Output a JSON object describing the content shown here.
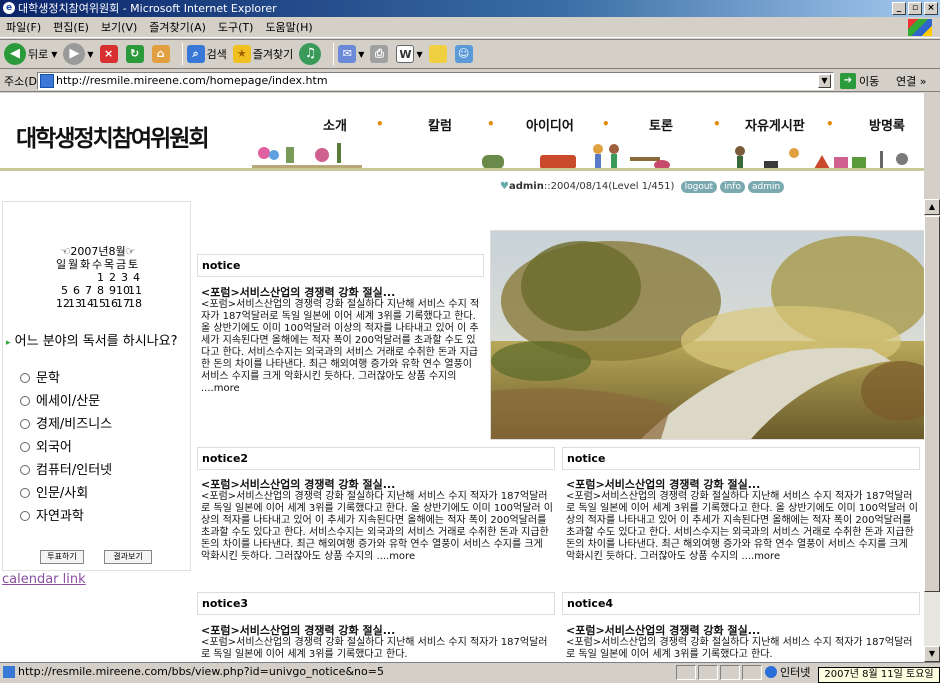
{
  "window": {
    "title": "대학생정치참여위원회 - Microsoft Internet Explorer"
  },
  "menu": [
    "파일(F)",
    "편집(E)",
    "보기(V)",
    "즐겨찾기(A)",
    "도구(T)",
    "도움말(H)"
  ],
  "toolbar": {
    "back": "뒤로",
    "search": "검색",
    "favorites": "즐겨찾기"
  },
  "address": {
    "label": "주소(D)",
    "url": "http://resmile.mireene.com/homepage/index.htm",
    "go": "이동",
    "links": "연결 »"
  },
  "site": {
    "logo": "대학생정치참여위원회",
    "nav": [
      "소개",
      "칼럼",
      "아이디어",
      "토론",
      "자유게시판",
      "방명록"
    ],
    "user": {
      "name": "admin",
      "info": "::2004/08/14(Level 1/451)",
      "buttons": [
        "logout",
        "info",
        "admin"
      ]
    }
  },
  "calendar": {
    "title": "☜2007년8월☞",
    "weekdays": [
      "일",
      "월",
      "화",
      "수",
      "목",
      "금",
      "토"
    ],
    "rows": [
      [
        "",
        "",
        "",
        "1",
        "2",
        "3",
        "4"
      ],
      [
        "5",
        "6",
        "7",
        "8",
        "9",
        "10",
        "11"
      ],
      [
        "12",
        "13",
        "14",
        "15",
        "16",
        "17",
        "18"
      ]
    ]
  },
  "poll": {
    "question": "어느 분야의 독서를 하시나요?",
    "options": [
      "문학",
      "에세이/산문",
      "경제/비즈니스",
      "외국어",
      "컴퓨터/인터넷",
      "인문/사회",
      "자연과학"
    ],
    "vote": "투표하기",
    "results": "결과보기"
  },
  "calendar_link": "calendar link",
  "notices": [
    {
      "title": "notice",
      "headline": "<포럼>서비스산업의 경쟁력 강화 절실...",
      "body": "<포럼>서비스산업의 경쟁력 강화 절실하다 지난해 서비스 수지 적자가 187억달러로 독일 일본에 이어 세계 3위를 기록했다고 한다. 올 상반기에도 이미 100억달러 이상의 적자를 나타내고 있어 이 추세가 지속된다면 올해에는 적자 폭이 200억달러를 초과할 수도 있다고 한다. 서비스수지는 외국과의 서비스 거래로 수취한 돈과 지급한 돈의 차이를 나타낸다. 최근 해외여행 증가와 유학 연수 열풍이 서비스 수지를 크게 악화시킨 듯하다. 그러잖아도 상품 수지의 ....",
      "more": "more"
    },
    {
      "title": "notice2",
      "headline": "<포럼>서비스산업의 경쟁력 강화 절실...",
      "body": "<포럼>서비스산업의 경쟁력 강화 절실하다 지난해 서비스 수지 적자가 187억달러로 독일 일본에 이어 세계 3위를 기록했다고 한다. 올 상반기에도 이미 100억달러 이상의 적자를 나타내고 있어 이 추세가 지속된다면 올해에는 적자 폭이 200억달러를 초과할 수도 있다고 한다. 서비스수지는 외국과의 서비스 거래로 수취한 돈과 지급한 돈의 차이를 나타낸다. 최근 해외여행 증가와 유학 연수 열풍이 서비스 수지를 크게 악화시킨 듯하다. 그러잖아도 상품 수지의 ....",
      "more": "more"
    },
    {
      "title": "notice",
      "headline": "<포럼>서비스산업의 경쟁력 강화 절실...",
      "body": "<포럼>서비스산업의 경쟁력 강화 절실하다 지난해 서비스 수지 적자가 187억달러로 독일 일본에 이어 세계 3위를 기록했다고 한다. 올 상반기에도 이미 100억달러 이상의 적자를 나타내고 있어 이 추세가 지속된다면 올해에는 적자 폭이 200억달러를 초과할 수도 있다고 한다. 서비스수지는 외국과의 서비스 거래로 수취한 돈과 지급한 돈의 차이를 나타낸다. 최근 해외여행 증가와 유학 연수 열풍이 서비스 수지를 크게 악화시킨 듯하다. 그러잖아도 상품 수지의 ....",
      "more": "more"
    },
    {
      "title": "notice3",
      "headline": "<포럼>서비스산업의 경쟁력 강화 절실...",
      "body": "<포럼>서비스산업의 경쟁력 강화 절실하다 지난해 서비스 수지 적자가 187억달러로 독일 일본에 이어 세계 3위를 기록했다고 한다.",
      "more": ""
    },
    {
      "title": "notice4",
      "headline": "<포럼>서비스산업의 경쟁력 강화 절실...",
      "body": "<포럼>서비스산업의 경쟁력 강화 절실하다 지난해 서비스 수지 적자가 187억달러로 독일 일본에 이어 세계 3위를 기록했다고 한다.",
      "more": ""
    }
  ],
  "status": {
    "url": "http://resmile.mireene.com/bbs/view.php?id=univgo_notice&no=5",
    "zone": "인터넷",
    "clock": "2007년 8월 11일 토요일"
  },
  "colors": {
    "titlebar": "#0a246a",
    "nav_dot": "#e68a00",
    "calendar_link": "#8a4fa0"
  }
}
